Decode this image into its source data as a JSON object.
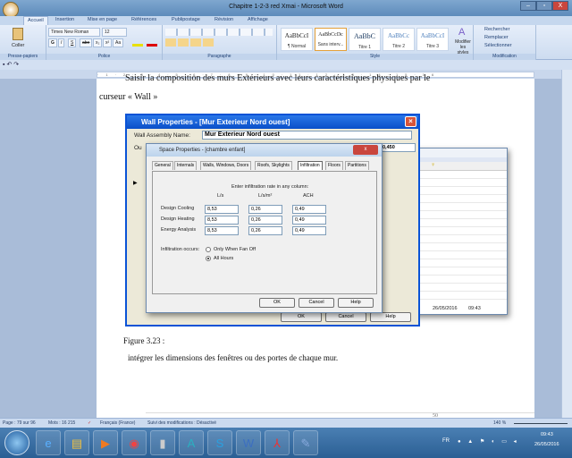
{
  "window": {
    "title": "Chapitre 1-2-3 red Xmai - Microsoft Word",
    "minimize": "–",
    "maximize": "▫",
    "close": "X"
  },
  "ribbon_tabs": [
    "Accueil",
    "Insertion",
    "Mise en page",
    "Références",
    "Publipostage",
    "Révision",
    "Affichage"
  ],
  "ribbon": {
    "clipboard": {
      "paste": "Coller",
      "label": "Presse-papiers"
    },
    "font": {
      "name": "Times New Roman",
      "size": "12",
      "label": "Police",
      "bold": "G",
      "italic": "I",
      "underline": "S",
      "strike": "abe",
      "sub": "x₂",
      "sup": "x²",
      "case": "Aa"
    },
    "paragraph": {
      "label": "Paragraphe"
    },
    "styles": {
      "label": "Style",
      "items": [
        {
          "preview": "AaBbCcI",
          "name": "¶ Normal"
        },
        {
          "preview": "AaBbCcDc",
          "name": "Sans interv..."
        },
        {
          "preview": "AaBbC",
          "name": "Titre 1"
        },
        {
          "preview": "AaBbCc",
          "name": "Titre 2"
        },
        {
          "preview": "AaBbCcI",
          "name": "Titre 3"
        }
      ],
      "change": "Modifier les styles"
    },
    "editing": {
      "label": "Modification",
      "find": "Rechercher",
      "replace": "Remplacer",
      "select": "Sélectionner"
    }
  },
  "document": {
    "line1": "Saisir la composition des murs Extérieurs avec leurs caractéristiques physiques par le",
    "line2": "curseur « Wall »",
    "caption": "Figure 3.23 :",
    "line3": "intégrer les dimensions des fenêtres ou des portes de chaque mur.",
    "page_number": "50"
  },
  "wall_dialog": {
    "title": "Wall Properties - [Mur Exterieur Nord ouest]",
    "name_label": "Wall Assembly Name:",
    "name_value": "Mur Exterieur Nord ouest",
    "partial_label": "Ou",
    "u_value": "0,450",
    "ok": "OK",
    "cancel": "Cancel",
    "help": "Help"
  },
  "back_window": {
    "date": "26/05/2016",
    "time": "09:43"
  },
  "space_dialog": {
    "title": "Space Properties - [chambre enfant]",
    "tabs": [
      "General",
      "Internals",
      "Walls, Windows, Doors",
      "Roofs, Skylights",
      "Infiltration",
      "Floors",
      "Partitions"
    ],
    "active_tab": "Infiltration",
    "instruction": "Enter infiltration rate in any column:",
    "columns": [
      "L/s",
      "L/s/m²",
      "ACH"
    ],
    "rows": [
      {
        "label": "Design Cooling",
        "values": [
          "8,53",
          "0,26",
          "0,49"
        ]
      },
      {
        "label": "Design Heating",
        "values": [
          "8,53",
          "0,26",
          "0,49"
        ]
      },
      {
        "label": "Energy Analysis",
        "values": [
          "8,53",
          "0,26",
          "0,49"
        ]
      }
    ],
    "occurs_label": "Infiltration occurs:",
    "options": [
      {
        "label": "Only When Fan Off",
        "selected": false
      },
      {
        "label": "All Hours",
        "selected": true
      }
    ],
    "ok": "OK",
    "cancel": "Cancel",
    "help": "Help",
    "close": "x"
  },
  "status": {
    "page": "Page : 79 sur 96",
    "words": "Mots : 16 215",
    "language": "Français (France)",
    "track": "Suivi des modifications : Désactivé",
    "zoom": "140 %"
  },
  "taskbar": {
    "lang": "FR",
    "time": "09:43",
    "date": "26/05/2016",
    "apps": [
      "start",
      "internet-explorer",
      "file-explorer",
      "media-player",
      "chrome",
      "app-dark",
      "autodesk",
      "skype",
      "word",
      "acrobat",
      "hap"
    ]
  }
}
